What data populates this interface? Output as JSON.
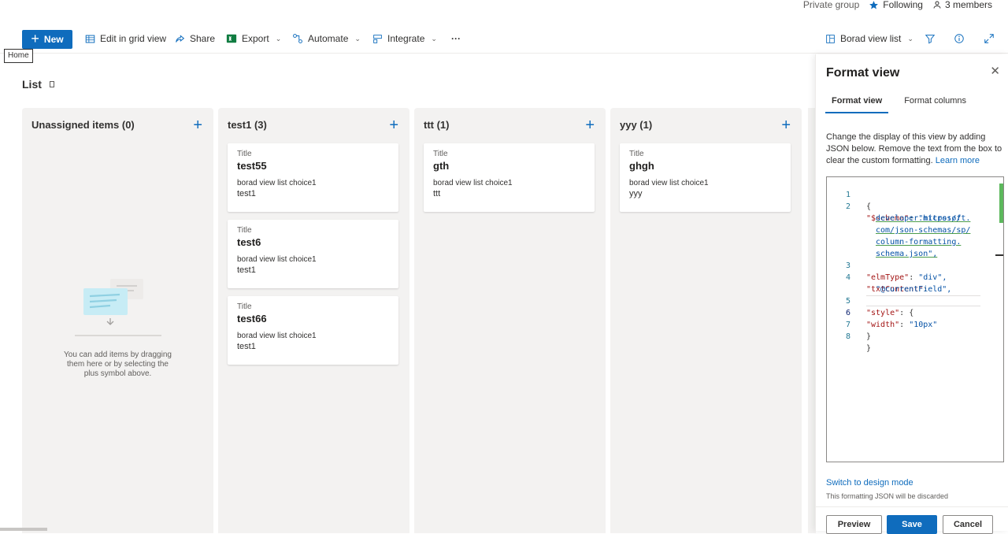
{
  "header": {
    "privacy": "Private group",
    "following": "Following",
    "members": "3 members"
  },
  "toolbar": {
    "new_label": "New",
    "edit_grid": "Edit in grid view",
    "share": "Share",
    "export": "Export",
    "automate": "Automate",
    "integrate": "Integrate",
    "more": "···",
    "view_name": "Borad view list",
    "tooltip": "Home"
  },
  "list": {
    "title": "List"
  },
  "columns": [
    {
      "heading": "Unassigned items (0)",
      "empty_message": "You can add items by dragging them here or by selecting the plus symbol above."
    },
    {
      "heading": "test1 (3)",
      "cards": [
        {
          "field_label": "Title",
          "title": "test55",
          "choice_label": "borad view list choice1",
          "choice": "test1"
        },
        {
          "field_label": "Title",
          "title": "test6",
          "choice_label": "borad view list choice1",
          "choice": "test1"
        },
        {
          "field_label": "Title",
          "title": "test66",
          "choice_label": "borad view list choice1",
          "choice": "test1"
        }
      ]
    },
    {
      "heading": "ttt (1)",
      "cards": [
        {
          "field_label": "Title",
          "title": "gth",
          "choice_label": "borad view list choice1",
          "choice": "ttt"
        }
      ]
    },
    {
      "heading": "yyy (1)",
      "cards": [
        {
          "field_label": "Title",
          "title": "ghgh",
          "choice_label": "borad view list choice1",
          "choice": "yyy"
        }
      ]
    }
  ],
  "panel": {
    "title": "Format view",
    "tabs": [
      "Format view",
      "Format columns"
    ],
    "description": "Change the display of this view by adding JSON below. Remove the text from the box to clear the custom formatting.",
    "learn_more": "Learn more",
    "code_lines": [
      {
        "num": "1",
        "text": "{"
      },
      {
        "num": "2",
        "key": "\"$schema\"",
        "url": [
          "\"https://",
          "developer.microsoft.",
          "com/json-schemas/sp/",
          "column-formatting.",
          "schema.json\","
        ]
      },
      {
        "num": "3",
        "key": "\"elmType\"",
        "val": "\"div\","
      },
      {
        "num": "4",
        "key": "\"txtContent\"",
        "val": "\"@currentField\","
      },
      {
        "num": "5",
        "key": "\"style\"",
        "val": "{"
      },
      {
        "num": "6",
        "key": "\"width\"",
        "val": "\"10px\""
      },
      {
        "num": "7",
        "text": "}"
      },
      {
        "num": "8",
        "text": "}"
      }
    ],
    "switch_link": "Switch to design mode",
    "discard_note": "This formatting JSON will be discarded",
    "buttons": {
      "preview": "Preview",
      "save": "Save",
      "cancel": "Cancel"
    }
  },
  "colors": {
    "accent": "#0f6cbd",
    "column_bg": "#f3f2f1"
  }
}
